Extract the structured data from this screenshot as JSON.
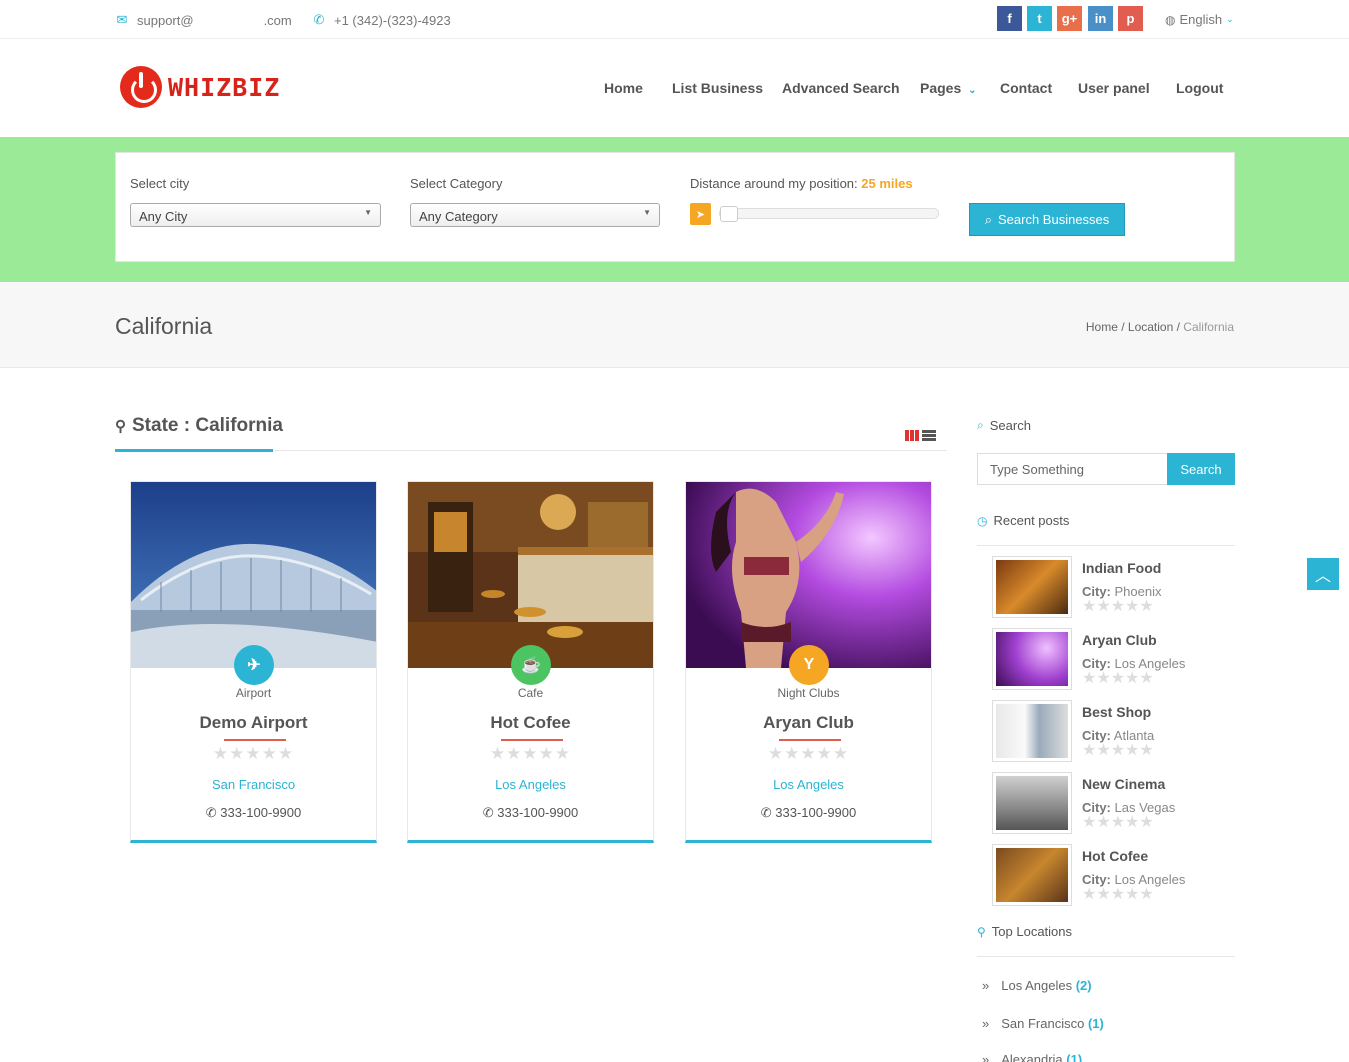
{
  "topbar": {
    "email_prefix": "support@",
    "email_suffix": ".com",
    "phone": "+1 (342)-(323)-4923",
    "social": [
      {
        "name": "facebook",
        "glyph": "f",
        "color": "#3b5998"
      },
      {
        "name": "twitter",
        "glyph": "t",
        "color": "#2bb4d4"
      },
      {
        "name": "google-plus",
        "glyph": "g+",
        "color": "#e86f4a"
      },
      {
        "name": "linkedin",
        "glyph": "in",
        "color": "#4a90c8"
      },
      {
        "name": "pinterest",
        "glyph": "p",
        "color": "#e05d4f"
      }
    ],
    "language": "English"
  },
  "header": {
    "logo_text": "WHIZBIZ",
    "nav": [
      "Home",
      "List Business",
      "Advanced Search",
      "Pages",
      "Contact",
      "User panel",
      "Logout"
    ]
  },
  "search": {
    "city_label": "Select city",
    "city_value": "Any City",
    "category_label": "Select Category",
    "category_value": "Any Category",
    "distance_label": "Distance around my position:",
    "distance_value": "25 miles",
    "distance_level_fraction": 0.0,
    "button_label": "Search Businesses"
  },
  "title_band": {
    "title": "California",
    "breadcrumb": [
      "Home",
      "Location",
      "California"
    ]
  },
  "main": {
    "state_title": "State : California",
    "cards": [
      {
        "category": "Airport",
        "name": "Demo Airport",
        "city": "San Francisco",
        "phone": "333-100-9900",
        "badge_color": "#2bb4d4",
        "badge_icon": "plane-icon",
        "rating": 0
      },
      {
        "category": "Cafe",
        "name": "Hot Cofee",
        "city": "Los Angeles",
        "phone": "333-100-9900",
        "badge_color": "#4cc462",
        "badge_icon": "coffee-icon",
        "rating": 0
      },
      {
        "category": "Night Clubs",
        "name": "Aryan Club",
        "city": "Los Angeles",
        "phone": "333-100-9900",
        "badge_color": "#f5a623",
        "badge_icon": "cocktail-icon",
        "rating": 0
      }
    ]
  },
  "sidebar": {
    "search_heading": "Search",
    "search_placeholder": "Type Something",
    "search_button": "Search",
    "recent_heading": "Recent posts",
    "city_prefix": "City:",
    "posts": [
      {
        "title": "Indian Food",
        "city": "Phoenix",
        "rating": 0
      },
      {
        "title": "Aryan Club",
        "city": "Los Angeles",
        "rating": 0
      },
      {
        "title": "Best Shop",
        "city": "Atlanta",
        "rating": 0
      },
      {
        "title": "New Cinema",
        "city": "Las Vegas",
        "rating": 0
      },
      {
        "title": "Hot Cofee",
        "city": "Los Angeles",
        "rating": 0
      }
    ],
    "locations_heading": "Top Locations",
    "locations": [
      {
        "name": "Los Angeles",
        "count": "(2)"
      },
      {
        "name": "San Francisco",
        "count": "(1)"
      },
      {
        "name": "Alexandria",
        "count": "(1)"
      }
    ]
  }
}
